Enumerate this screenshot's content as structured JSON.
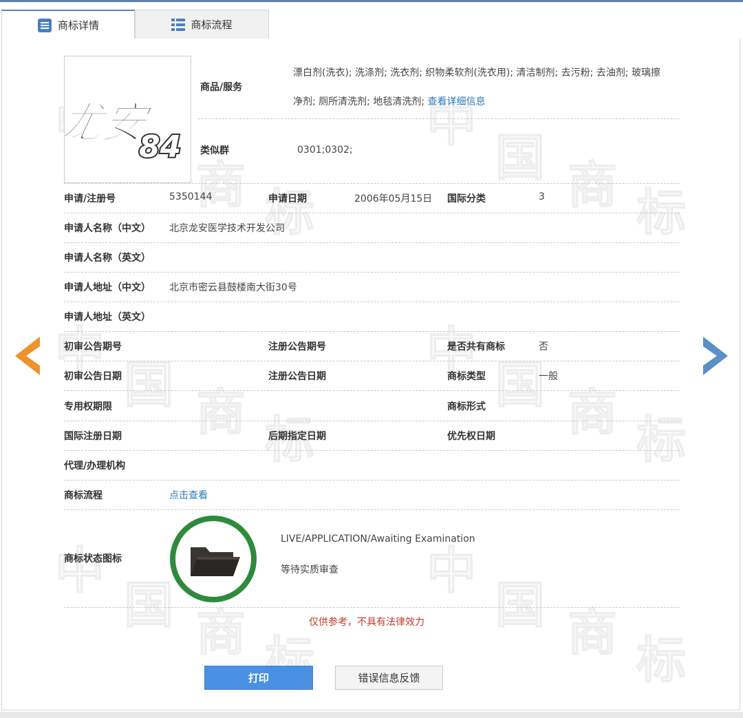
{
  "tabs": [
    {
      "label": "商标详情",
      "icon": "details-list-icon",
      "active": true
    },
    {
      "label": "商标流程",
      "icon": "flow-list-icon",
      "active": false
    }
  ],
  "logo": {
    "text_main": "龙安",
    "text_num": "84"
  },
  "goods_services": {
    "label": "商品/服务",
    "line1": "漂白剂(洗衣); 洗涤剂; 洗衣剂; 织物柔软剂(洗衣用); 清洁制剂; 去污粉; 去油剂; 玻璃擦",
    "line2": "净剂; 厕所清洗剂; 地毯清洗剂;",
    "more_link": "查看详细信息"
  },
  "similar_group": {
    "label": "类似群",
    "value": "0301;0302;"
  },
  "rows": {
    "reg_no": {
      "label": "申请/注册号",
      "value": "5350144"
    },
    "app_date": {
      "label": "申请日期",
      "value": "2006年05月15日"
    },
    "intl_class": {
      "label": "国际分类",
      "value": "3"
    },
    "applicant_cn": {
      "label": "申请人名称（中文）",
      "value": "北京龙安医学技术开发公司"
    },
    "applicant_en": {
      "label": "申请人名称（英文）",
      "value": ""
    },
    "address_cn": {
      "label": "申请人地址（中文）",
      "value": "北京市密云县鼓楼南大街30号"
    },
    "address_en": {
      "label": "申请人地址（英文）",
      "value": ""
    },
    "prelim_pub_no": {
      "label": "初审公告期号",
      "value": ""
    },
    "reg_pub_no": {
      "label": "注册公告期号",
      "value": ""
    },
    "shared": {
      "label": "是否共有商标",
      "value": "否"
    },
    "prelim_pub_date": {
      "label": "初审公告日期",
      "value": ""
    },
    "reg_pub_date": {
      "label": "注册公告日期",
      "value": ""
    },
    "mark_type": {
      "label": "商标类型",
      "value": "一般"
    },
    "exclusive_period": {
      "label": "专用权期限",
      "value": ""
    },
    "mark_form": {
      "label": "商标形式",
      "value": ""
    },
    "intl_reg_date": {
      "label": "国际注册日期",
      "value": ""
    },
    "later_designation": {
      "label": "后期指定日期",
      "value": ""
    },
    "priority_date": {
      "label": "优先权日期",
      "value": ""
    },
    "agent": {
      "label": "代理/办理机构",
      "value": ""
    },
    "process": {
      "label": "商标流程",
      "link": "点击查看"
    }
  },
  "status": {
    "label": "商标状态图标",
    "icon": "folder-icon",
    "text_en": "LIVE/APPLICATION/Awaiting Examination",
    "text_cn": "等待实质审查"
  },
  "disclaimer": "仅供参考，不具有法律效力",
  "buttons": {
    "print": "打印",
    "feedback": "错误信息反馈"
  },
  "watermark": [
    "中",
    "国",
    "商",
    "标"
  ],
  "colors": {
    "accent": "#4a90e2",
    "status_green": "#2e8b3c",
    "disclaimer_red": "#c0392b",
    "prev_arrow": "#f0922b",
    "next_arrow": "#5b8fc7",
    "link": "#2a7ab7"
  }
}
